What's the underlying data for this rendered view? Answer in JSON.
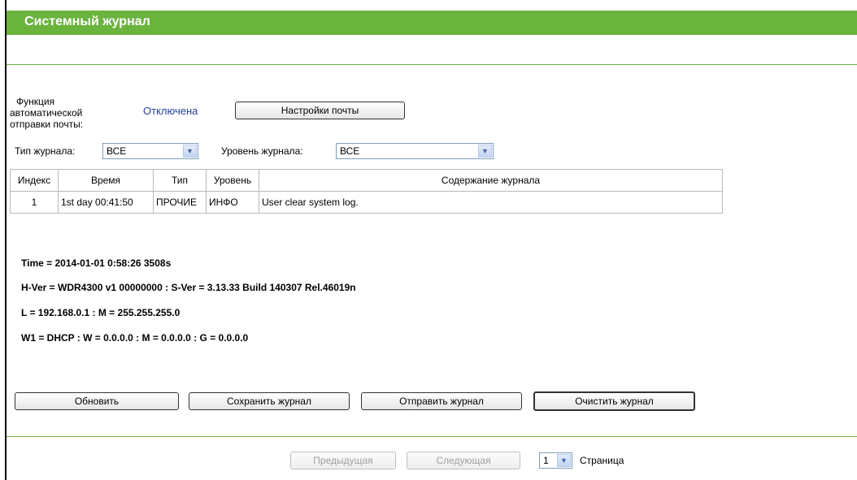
{
  "page": {
    "title": "Системный журнал"
  },
  "mail": {
    "label_lines": [
      "Функция",
      "автоматической",
      "отправки почты:"
    ],
    "status": "Отключена",
    "settings_button": "Настройки почты"
  },
  "filters": {
    "type_label": "Тип журнала:",
    "type_value": "ВСЕ",
    "level_label": "Уровень журнала:",
    "level_value": "ВСЕ"
  },
  "table": {
    "headers": [
      "Индекс",
      "Время",
      "Тип",
      "Уровень",
      "Содержание журнала"
    ],
    "rows": [
      {
        "index": "1",
        "time": "1st day 00:41:50",
        "type": "ПРОЧИЕ",
        "level": "ИНФО",
        "content": "User clear system log."
      }
    ]
  },
  "system_info": {
    "time": "Time = 2014-01-01 0:58:26 3508s",
    "version": "H-Ver = WDR4300 v1 00000000 : S-Ver = 3.13.33 Build 140307 Rel.46019n",
    "lan": "L = 192.168.0.1 : M = 255.255.255.0",
    "wan": "W1 = DHCP : W = 0.0.0.0 : M = 0.0.0.0 : G = 0.0.0.0"
  },
  "actions": {
    "refresh": "Обновить",
    "save": "Сохранить журнал",
    "send": "Отправить журнал",
    "clear": "Очистить журнал"
  },
  "pagination": {
    "prev": "Предыдущая",
    "next": "Следующая",
    "page_value": "1",
    "page_label": "Страница"
  },
  "colors": {
    "header_green": "#6ab43e",
    "status_blue": "#1f3f9b"
  },
  "icons": {
    "dropdown": "chevron-down-icon"
  }
}
